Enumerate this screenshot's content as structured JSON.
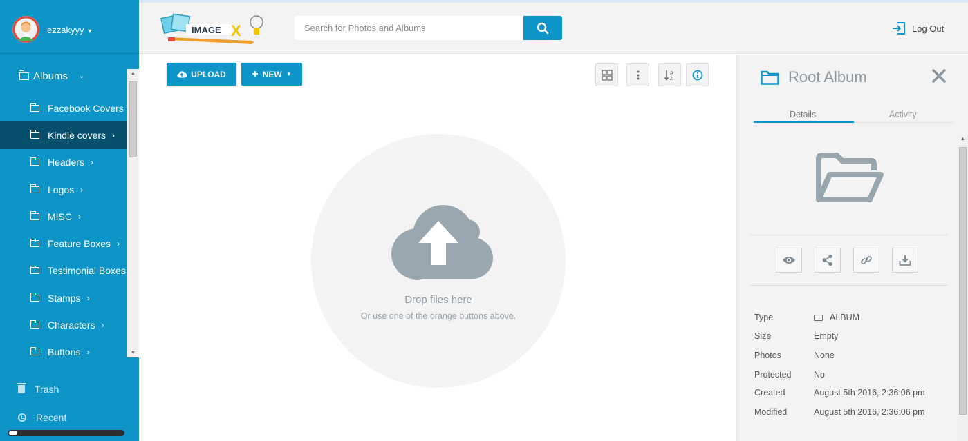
{
  "user": {
    "name": "ezzakyyy"
  },
  "sidebar": {
    "albums_label": "Albums",
    "albums": [
      {
        "label": "Facebook Covers",
        "has_children": false,
        "active": false
      },
      {
        "label": "Kindle covers",
        "has_children": true,
        "active": true
      },
      {
        "label": "Headers",
        "has_children": true,
        "active": false
      },
      {
        "label": "Logos",
        "has_children": true,
        "active": false
      },
      {
        "label": "MISC",
        "has_children": true,
        "active": false
      },
      {
        "label": "Feature Boxes",
        "has_children": true,
        "active": false
      },
      {
        "label": "Testimonial Boxes",
        "has_children": false,
        "active": false
      },
      {
        "label": "Stamps",
        "has_children": true,
        "active": false
      },
      {
        "label": "Characters",
        "has_children": true,
        "active": false
      },
      {
        "label": "Buttons",
        "has_children": true,
        "active": false
      }
    ],
    "trash_label": "Trash",
    "recent_label": "Recent"
  },
  "header": {
    "logo_text": "IMAGE",
    "logo_x": "X",
    "search_placeholder": "Search for Photos and Albums",
    "logout_label": "Log Out"
  },
  "toolbar": {
    "upload_label": "UPLOAD",
    "new_label": "NEW"
  },
  "dropzone": {
    "title": "Drop files here",
    "subtitle": "Or use one of the orange buttons above."
  },
  "panel": {
    "title": "Root Album",
    "tabs": {
      "details": "Details",
      "activity": "Activity"
    },
    "props": [
      {
        "label": "Type",
        "value": "ALBUM"
      },
      {
        "label": "Size",
        "value": "Empty"
      },
      {
        "label": "Photos",
        "value": "None"
      },
      {
        "label": "Protected",
        "value": "No"
      },
      {
        "label": "Created",
        "value": "August 5th 2016, 2:36:06 pm"
      },
      {
        "label": "Modified",
        "value": "August 5th 2016, 2:36:06 pm"
      }
    ]
  },
  "colors": {
    "accent": "#0d95c8",
    "active_item": "#06506e",
    "muted_icon": "#98a6b0"
  }
}
